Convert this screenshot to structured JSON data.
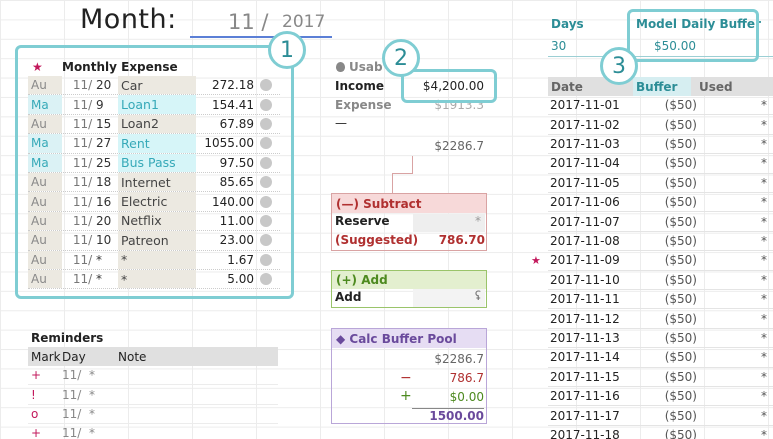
{
  "header": {
    "month_label": "Month:",
    "month": "11",
    "slash": "/",
    "year": "2017"
  },
  "expenses": {
    "star": "★",
    "title": "Monthly Expense",
    "rows": [
      {
        "mark": "Au",
        "month": "11/",
        "day": "20",
        "name": "Car",
        "amount": "272.18",
        "type": "au"
      },
      {
        "mark": "Ma",
        "month": "11/",
        "day": "9",
        "name": "Loan1",
        "amount": "154.41",
        "type": "ma"
      },
      {
        "mark": "Au",
        "month": "11/",
        "day": "15",
        "name": "Loan2",
        "amount": "67.89",
        "type": "au"
      },
      {
        "mark": "Ma",
        "month": "11/",
        "day": "27",
        "name": "Rent",
        "amount": "1055.00",
        "type": "ma"
      },
      {
        "mark": "Ma",
        "month": "11/",
        "day": "25",
        "name": "Bus Pass",
        "amount": "97.50",
        "type": "ma"
      },
      {
        "mark": "Au",
        "month": "11/",
        "day": "18",
        "name": "Internet",
        "amount": "85.65",
        "type": "au"
      },
      {
        "mark": "Au",
        "month": "11/",
        "day": "16",
        "name": "Electric",
        "amount": "140.00",
        "type": "au"
      },
      {
        "mark": "Au",
        "month": "11/",
        "day": "20",
        "name": "Netflix",
        "amount": "11.00",
        "type": "au"
      },
      {
        "mark": "Au",
        "month": "11/",
        "day": "10",
        "name": "Patreon",
        "amount": "23.00",
        "type": "au"
      },
      {
        "mark": "Au",
        "month": "11/",
        "day": "*",
        "name": "*",
        "amount": "1.67",
        "type": "au"
      },
      {
        "mark": "Au",
        "month": "11/",
        "day": "*",
        "name": "*",
        "amount": "5.00",
        "type": "au"
      }
    ]
  },
  "callouts": {
    "one": "1",
    "two": "2",
    "three": "3"
  },
  "usable": {
    "header": "Usab",
    "income_label": "Income",
    "income_value": "$4,200.00",
    "expense_label": "Expense",
    "expense_value": "$1913.3",
    "minus": "—",
    "remaining": "$2286.7"
  },
  "subtract": {
    "title": "(—) Subtract",
    "reserve_label": "Reserve",
    "reserve_value": "*",
    "suggested_label": "(Suggested)",
    "suggested_value": "786.70"
  },
  "add": {
    "title": "(+) Add",
    "label": "Add",
    "value": "ʢ"
  },
  "calc": {
    "title": "◆ Calc Buffer Pool",
    "total": "$2286.7",
    "minus_sign": "−",
    "minus_value": "786.7",
    "plus_sign": "+",
    "plus_value": "$0.00",
    "result": "1500.00"
  },
  "reminders": {
    "title": "Reminders",
    "headers": [
      "Mark",
      "Day",
      "Note"
    ],
    "rows": [
      {
        "mark": "+",
        "month": "11/",
        "day": "*"
      },
      {
        "mark": "!",
        "month": "11/",
        "day": "*"
      },
      {
        "mark": "o",
        "month": "11/",
        "day": "*"
      },
      {
        "mark": "+",
        "month": "11/",
        "day": "*"
      }
    ]
  },
  "days": {
    "label": "Days",
    "value": "30"
  },
  "model_buffer": {
    "label": "Model Daily Buffer",
    "value": "$50.00"
  },
  "daily": {
    "headers": [
      "Date",
      "Buffer",
      "Used"
    ],
    "flag_star": "★",
    "rows": [
      {
        "date": "2017-11-01",
        "buffer": "($50)",
        "used": "*"
      },
      {
        "date": "2017-11-02",
        "buffer": "($50)",
        "used": "*"
      },
      {
        "date": "2017-11-03",
        "buffer": "($50)",
        "used": "*"
      },
      {
        "date": "2017-11-04",
        "buffer": "($50)",
        "used": "*"
      },
      {
        "date": "2017-11-05",
        "buffer": "($50)",
        "used": "*"
      },
      {
        "date": "2017-11-06",
        "buffer": "($50)",
        "used": "*"
      },
      {
        "date": "2017-11-07",
        "buffer": "($50)",
        "used": "*"
      },
      {
        "date": "2017-11-08",
        "buffer": "($50)",
        "used": "*"
      },
      {
        "date": "2017-11-09",
        "buffer": "($50)",
        "used": "*"
      },
      {
        "date": "2017-11-10",
        "buffer": "($50)",
        "used": "*"
      },
      {
        "date": "2017-11-11",
        "buffer": "($50)",
        "used": "*"
      },
      {
        "date": "2017-11-12",
        "buffer": "($50)",
        "used": "*"
      },
      {
        "date": "2017-11-13",
        "buffer": "($50)",
        "used": "*"
      },
      {
        "date": "2017-11-14",
        "buffer": "($50)",
        "used": "*"
      },
      {
        "date": "2017-11-15",
        "buffer": "($50)",
        "used": "*"
      },
      {
        "date": "2017-11-16",
        "buffer": "($50)",
        "used": "*"
      },
      {
        "date": "2017-11-17",
        "buffer": "($50)",
        "used": "*"
      },
      {
        "date": "2017-11-18",
        "buffer": "($50)",
        "used": "*"
      }
    ]
  },
  "colors": {
    "accent": "#7fcdd3",
    "au_bg": "#ece9e1",
    "ma_bg": "#dbf2f5",
    "ma_text": "#36a9b8",
    "subtract": "#b03030",
    "add": "#4d8a1f",
    "calc": "#6a4a9c"
  }
}
